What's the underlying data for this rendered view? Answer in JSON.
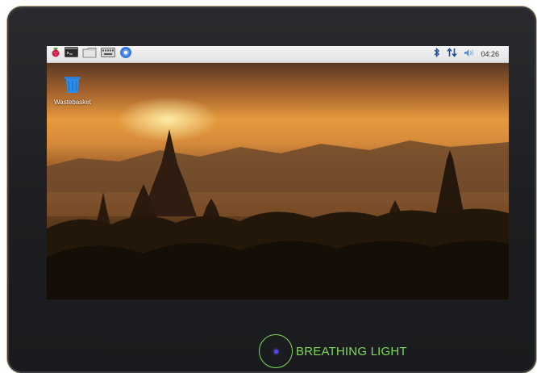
{
  "taskbar": {
    "app_icons": [
      "raspberry-menu-icon",
      "terminal-icon",
      "file-manager-icon",
      "keyboard-icon",
      "browser-icon"
    ],
    "status_icons": [
      "bluetooth-icon",
      "network-icon",
      "volume-icon"
    ],
    "clock": "04:26"
  },
  "desktop": {
    "wastebasket_label": "Wastebasket"
  },
  "device": {
    "breathing_light_label": "BREATHING LIGHT"
  },
  "colors": {
    "bezel": "#222326",
    "indicator_green": "#7ed957",
    "indicator_dot": "#5b46ff"
  }
}
